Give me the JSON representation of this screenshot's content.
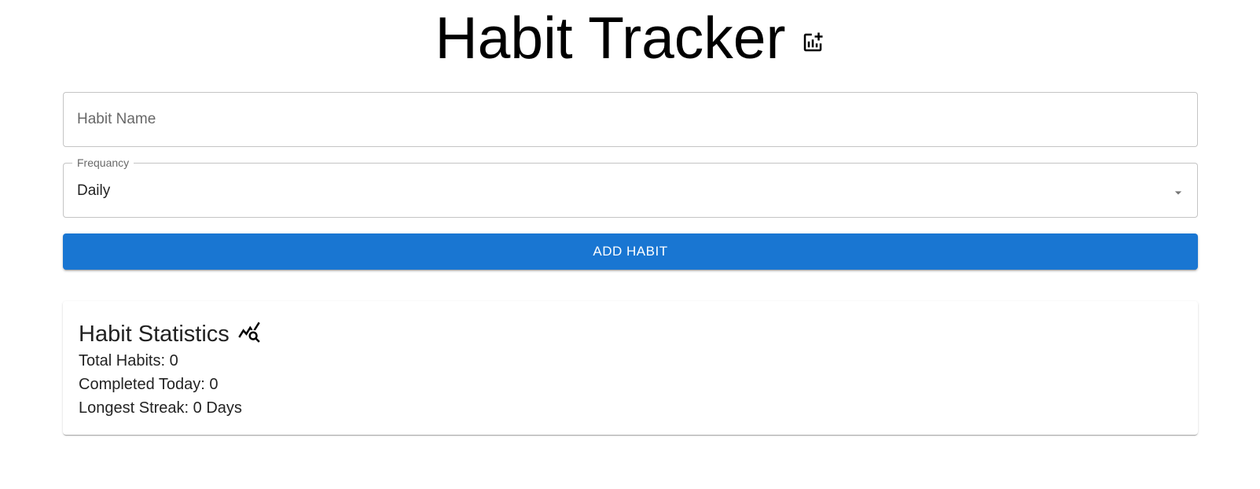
{
  "header": {
    "title": "Habit Tracker",
    "icon": "add-chart-icon"
  },
  "form": {
    "habit_name": {
      "placeholder": "Habit Name",
      "value": ""
    },
    "frequency": {
      "label": "Frequancy",
      "selected": "Daily",
      "icon": "arrow-drop-down-icon"
    },
    "add_button_label": "ADD HABIT"
  },
  "stats": {
    "title": "Habit Statistics",
    "icon": "query-stats-icon",
    "items": [
      {
        "label": "Total Habits:",
        "value": "0",
        "unit": ""
      },
      {
        "label": "Completed Today:",
        "value": "0",
        "unit": ""
      },
      {
        "label": "Longest Streak:",
        "value": "0",
        "unit": "Days"
      }
    ]
  },
  "colors": {
    "primary": "#1976d2",
    "text": "#000000"
  }
}
